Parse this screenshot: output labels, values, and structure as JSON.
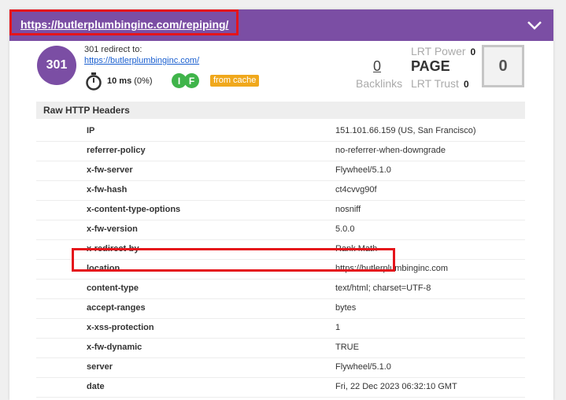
{
  "header": {
    "url": "https://butlerplumbinginc.com/repiping/",
    "accent_color": "#7b4ea4",
    "highlight_color": "#e5141b"
  },
  "summary": {
    "status_code": "301",
    "redirect_label": "301 redirect to:",
    "redirect_url": "https://butlerplumbinginc.com/",
    "time": "10 ms",
    "time_pct": "(0%)",
    "badge_i": "I",
    "badge_f": "F",
    "cache_label": "from cache"
  },
  "metrics": {
    "backlinks_value": "0",
    "backlinks_label": "Backlinks",
    "lrt_power_label": "LRT Power",
    "lrt_power_value": "0",
    "page_label": "PAGE",
    "lrt_trust_label": "LRT Trust",
    "lrt_trust_value": "0",
    "score": "0"
  },
  "raw_headers": {
    "title": "Raw HTTP Headers",
    "rows": [
      {
        "key": "IP",
        "value": "151.101.66.159 (US, San Francisco)"
      },
      {
        "key": "referrer-policy",
        "value": "no-referrer-when-downgrade"
      },
      {
        "key": "x-fw-server",
        "value": "Flywheel/5.1.0"
      },
      {
        "key": "x-fw-hash",
        "value": "ct4cvvg90f"
      },
      {
        "key": "x-content-type-options",
        "value": "nosniff"
      },
      {
        "key": "x-fw-version",
        "value": "5.0.0"
      },
      {
        "key": "x-redirect-by",
        "value": "Rank Math"
      },
      {
        "key": "location",
        "value": "https://butlerplumbinginc.com"
      },
      {
        "key": "content-type",
        "value": "text/html; charset=UTF-8"
      },
      {
        "key": "accept-ranges",
        "value": "bytes"
      },
      {
        "key": "x-xss-protection",
        "value": "1"
      },
      {
        "key": "x-fw-dynamic",
        "value": "TRUE"
      },
      {
        "key": "server",
        "value": "Flywheel/5.1.0"
      },
      {
        "key": "date",
        "value": "Fri, 22 Dec 2023 06:32:10 GMT"
      }
    ]
  }
}
